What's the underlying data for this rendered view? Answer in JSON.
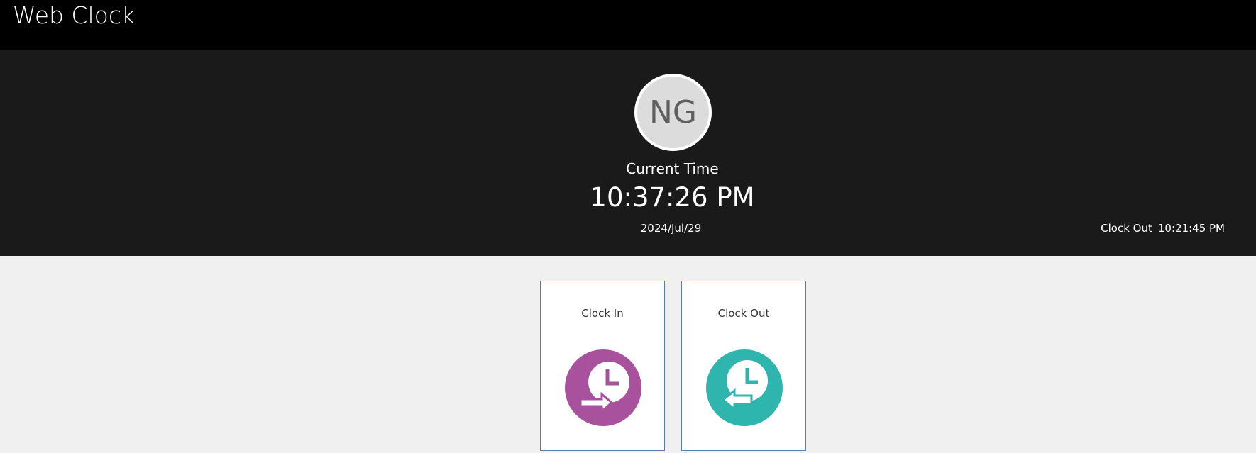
{
  "app": {
    "title": "Web Clock"
  },
  "user": {
    "initials": "NG"
  },
  "clock": {
    "label": "Current Time",
    "time": "10:37:26 PM",
    "date": "2024/Jul/29"
  },
  "last_punch": {
    "action": "Clock Out",
    "time": "10:21:45 PM"
  },
  "actions": [
    {
      "label": "Clock In",
      "icon": "clock-in-icon",
      "color": "#a8519c"
    },
    {
      "label": "Clock Out",
      "icon": "clock-out-icon",
      "color": "#2db5ae"
    }
  ],
  "colors": {
    "topbar": "#000000",
    "hero": "#1a1a1a",
    "page": "#f0f0f0",
    "tile_border": "#5b7bb0"
  }
}
